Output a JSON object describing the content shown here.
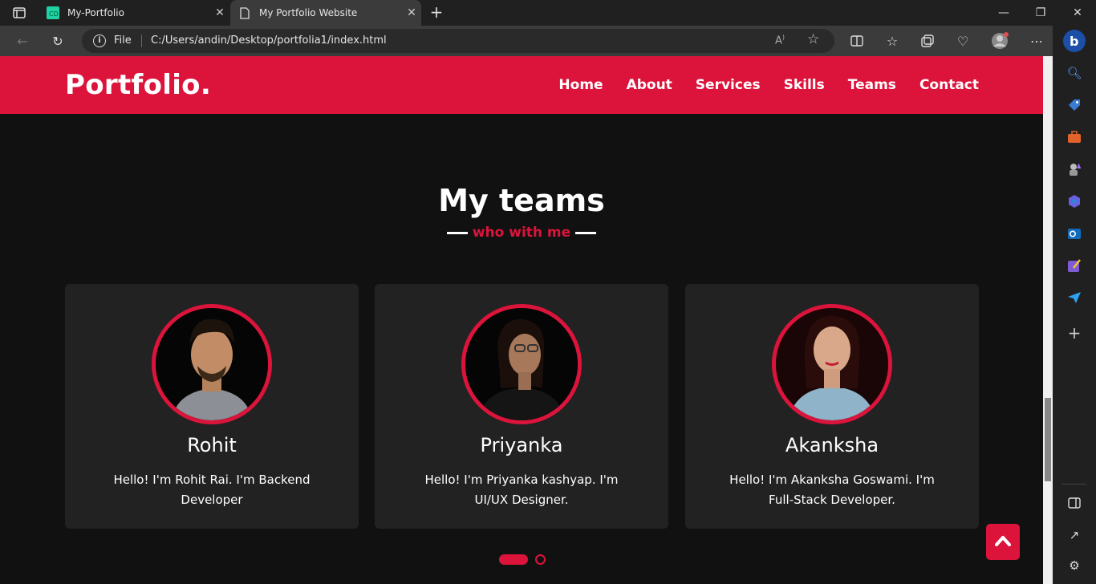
{
  "browser": {
    "tabs": [
      {
        "title": "My-Portfolio",
        "active": false
      },
      {
        "title": "My Portfolio Website",
        "active": true
      }
    ],
    "address": {
      "scheme_label": "File",
      "url": "C:/Users/andin/Desktop/portfolia1/index.html"
    },
    "accent": "#dc143c"
  },
  "site": {
    "logo": "Portfolio.",
    "menu": [
      "Home",
      "About",
      "Services",
      "Skills",
      "Teams",
      "Contact"
    ]
  },
  "teams": {
    "title": "My teams",
    "subtitle": "who with me",
    "members": [
      {
        "name": "Rohit",
        "description": "Hello! I'm Rohit Rai. I'm Backend Developer"
      },
      {
        "name": "Priyanka",
        "description": "Hello! I'm Priyanka kashyap. I'm UI/UX Designer."
      },
      {
        "name": "Akanksha",
        "description": "Hello! I'm Akanksha Goswami. I'm Full-Stack Developer."
      }
    ],
    "carousel_pages": 2,
    "carousel_active": 1
  },
  "icons": {
    "scroll_top": "chevron-up-icon"
  }
}
